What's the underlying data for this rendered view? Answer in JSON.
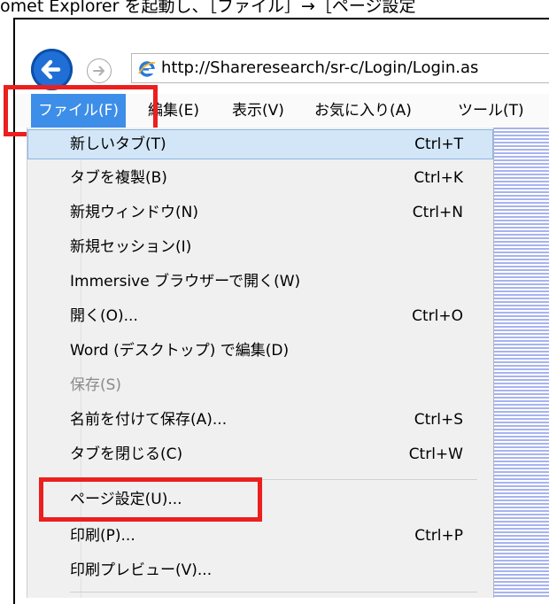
{
  "caption": "omet Explorer を起動し、［ファイル］→［ページ設定",
  "nav": {
    "url": "http://Shareresearch/sr-c/Login/Login.as"
  },
  "menubar": {
    "items": [
      "ファイル(F)",
      "編集(E)",
      "表示(V)",
      "お気に入り(A)",
      "ツール(T)"
    ]
  },
  "dropdown": {
    "items": [
      {
        "label": "新しいタブ(T)",
        "shortcut": "Ctrl+T"
      },
      {
        "label": "タブを複製(B)",
        "shortcut": "Ctrl+K"
      },
      {
        "label": "新規ウィンドウ(N)",
        "shortcut": "Ctrl+N"
      },
      {
        "label": "新規セッション(I)",
        "shortcut": ""
      },
      {
        "label": "Immersive ブラウザーで開く(W)",
        "shortcut": ""
      },
      {
        "label": "開く(O)...",
        "shortcut": "Ctrl+O"
      },
      {
        "label": "Word (デスクトップ) で編集(D)",
        "shortcut": ""
      },
      {
        "label": "保存(S)",
        "shortcut": ""
      },
      {
        "label": "名前を付けて保存(A)...",
        "shortcut": "Ctrl+S"
      },
      {
        "label": "タブを閉じる(C)",
        "shortcut": "Ctrl+W"
      },
      {
        "label": "ページ設定(U)...",
        "shortcut": ""
      },
      {
        "label": "印刷(P)...",
        "shortcut": "Ctrl+P"
      },
      {
        "label": "印刷プレビュー(V)...",
        "shortcut": ""
      }
    ]
  },
  "colors": {
    "highlight_box": "#ec1f1f",
    "menu_active": "#3d8ee8",
    "back_button": "#1f6fd6"
  }
}
